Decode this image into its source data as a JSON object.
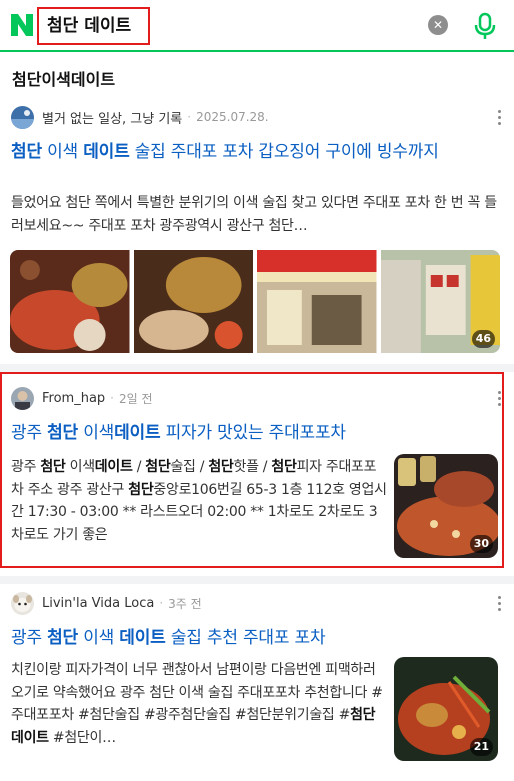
{
  "search": {
    "query": "첨단 데이트",
    "clear_symbol": "✕"
  },
  "section_title": "첨단이색데이트",
  "posts": [
    {
      "author": "별거 없는 일상, 그냥 기록",
      "date": "2025.07.28.",
      "title_parts": [
        "첨단",
        " 이색 ",
        "데이트",
        " 술집 주대포 포차 갑오징어 구이에 빙수까지"
      ],
      "desc": "들었어요 첨단 쪽에서 특별한 분위기의 이색 술집 찾고 있다면 주대포 포차 한 번 꼭 들러보세요~~ 주대포 포차 광주광역시 광산구 첨단…",
      "photo_count": "46"
    },
    {
      "author": "From_hap",
      "date": "2일 전",
      "title_parts": [
        "광주 ",
        "첨단",
        " 이색",
        "데이트",
        " 피자가 맛있는 주대포포차"
      ],
      "desc_parts": [
        "광주 ",
        "첨단",
        " 이색",
        "데이트",
        " / ",
        "첨단",
        "술집 / ",
        "첨단",
        "핫플 / ",
        "첨단",
        "피자 주대포포차 주소 광주 광산구 ",
        "첨단",
        "중앙로106번길 65-3 1층 112호 영업시간 17:30 - 03:00 ** 라스트오더 02:00 ** 1차로도 2차로도 3차로도 가기 좋은 ",
        "첨단",
        " …"
      ],
      "photo_count": "30"
    },
    {
      "author": "Livin'la Vida Loca",
      "date": "3주 전",
      "title_parts": [
        "광주 ",
        "첨단",
        " 이색 ",
        "데이트",
        " 술집 추천 주대포 포차"
      ],
      "desc_parts": [
        "치킨이랑 피자가격이 너무 괜찮아서 남편이랑 다음번엔 피맥하러 오기로 약속했어요 광주 첨단 이색 술집 주대포포차 추천합니다 #주대포포차 #첨단술집 #광주첨단술집 #첨단분위기술집 #",
        "첨단데이트",
        " #첨단이…"
      ],
      "photo_count": "21"
    }
  ],
  "colors": {
    "brand": "#03c75a",
    "link": "#0b5fc2",
    "highlight": "#e21b1b"
  }
}
